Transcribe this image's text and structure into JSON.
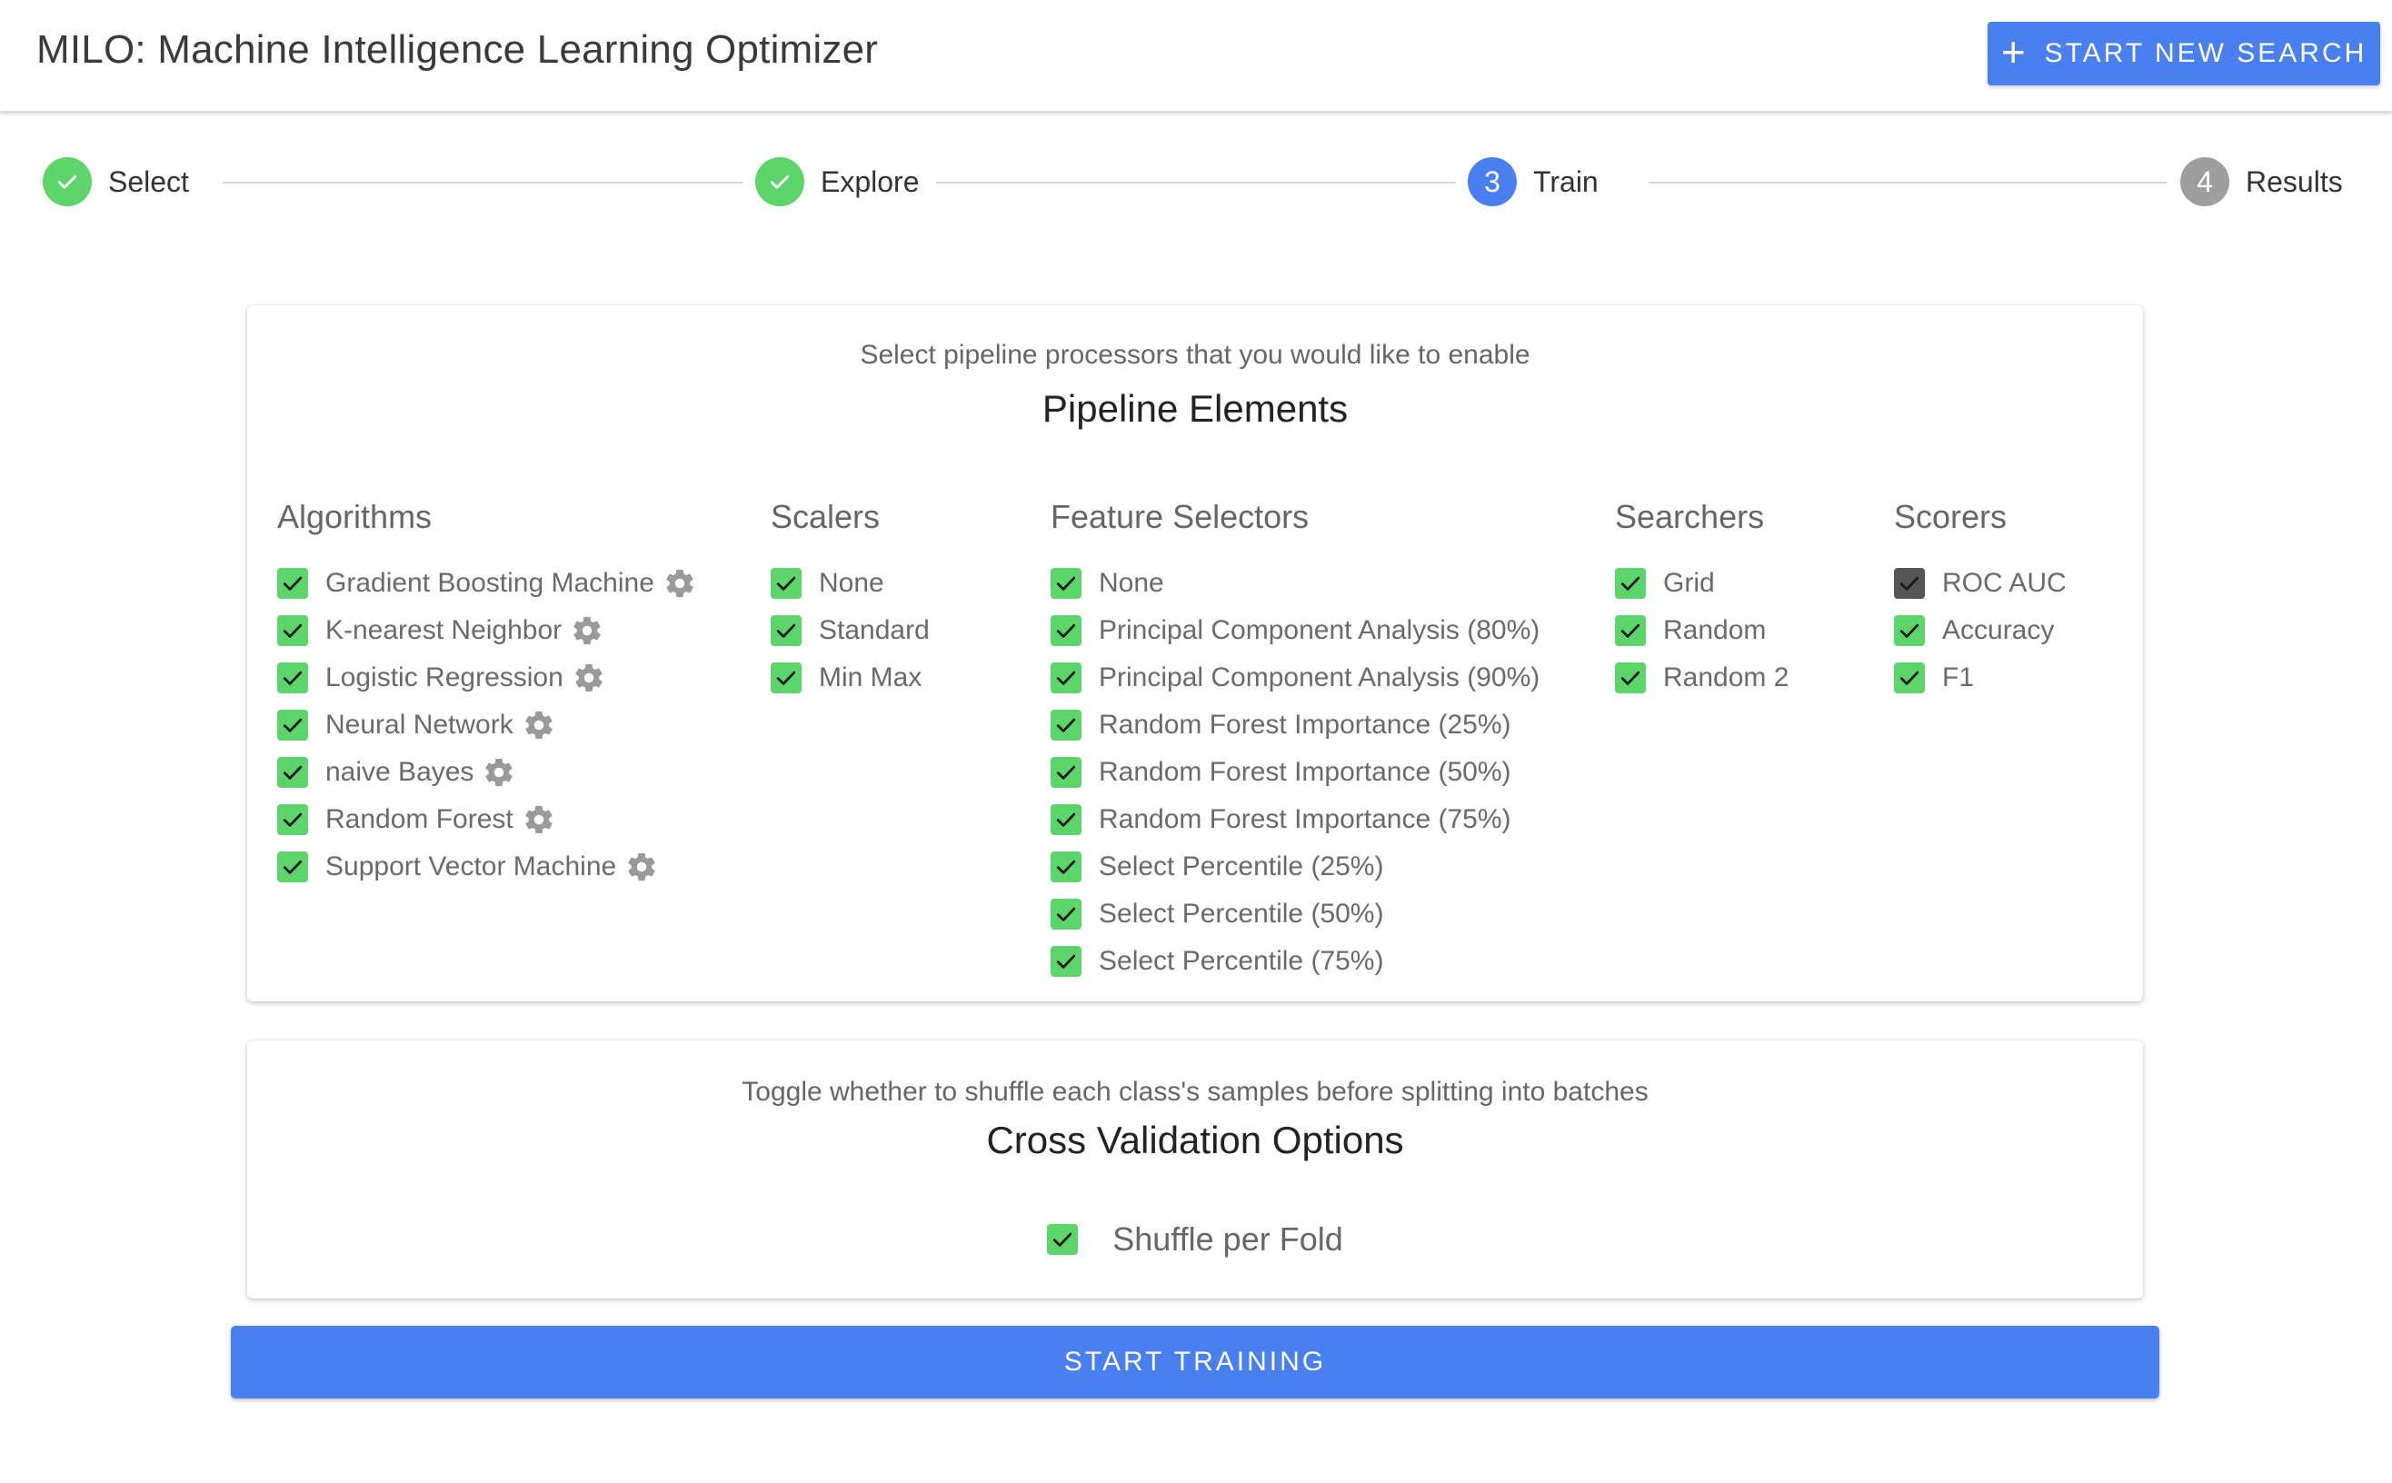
{
  "app": {
    "title": "MILO: Machine Intelligence Learning Optimizer",
    "new_search_label": "START NEW SEARCH",
    "accent_color": "#4a7ff0",
    "success_color": "#5cd56a"
  },
  "stepper": {
    "steps": [
      {
        "label": "Select",
        "state": "done",
        "icon": "check-icon"
      },
      {
        "label": "Explore",
        "state": "done",
        "icon": "check-icon"
      },
      {
        "label": "Train",
        "state": "active",
        "number": "3"
      },
      {
        "label": "Results",
        "state": "todo",
        "number": "4"
      }
    ]
  },
  "pipeline": {
    "subtitle": "Select pipeline processors that you would like to enable",
    "title": "Pipeline Elements",
    "columns": {
      "algorithms": {
        "heading": "Algorithms",
        "items": [
          {
            "label": "Gradient Boosting Machine",
            "checked": true,
            "settings_icon": "gear-icon"
          },
          {
            "label": "K-nearest Neighbor",
            "checked": true,
            "settings_icon": "gear-icon"
          },
          {
            "label": "Logistic Regression",
            "checked": true,
            "settings_icon": "gear-icon"
          },
          {
            "label": "Neural Network",
            "checked": true,
            "settings_icon": "gear-icon"
          },
          {
            "label": "naive Bayes",
            "checked": true,
            "settings_icon": "gear-icon"
          },
          {
            "label": "Random Forest",
            "checked": true,
            "settings_icon": "gear-icon"
          },
          {
            "label": "Support Vector Machine",
            "checked": true,
            "settings_icon": "gear-icon"
          }
        ]
      },
      "scalers": {
        "heading": "Scalers",
        "items": [
          {
            "label": "None",
            "checked": true
          },
          {
            "label": "Standard",
            "checked": true
          },
          {
            "label": "Min Max",
            "checked": true
          }
        ]
      },
      "feature_selectors": {
        "heading": "Feature Selectors",
        "items": [
          {
            "label": "None",
            "checked": true
          },
          {
            "label": "Principal Component Analysis (80%)",
            "checked": true
          },
          {
            "label": "Principal Component Analysis (90%)",
            "checked": true
          },
          {
            "label": "Random Forest Importance (25%)",
            "checked": true
          },
          {
            "label": "Random Forest Importance (50%)",
            "checked": true
          },
          {
            "label": "Random Forest Importance (75%)",
            "checked": true
          },
          {
            "label": "Select Percentile (25%)",
            "checked": true
          },
          {
            "label": "Select Percentile (50%)",
            "checked": true
          },
          {
            "label": "Select Percentile (75%)",
            "checked": true
          }
        ]
      },
      "searchers": {
        "heading": "Searchers",
        "items": [
          {
            "label": "Grid",
            "checked": true
          },
          {
            "label": "Random",
            "checked": true
          },
          {
            "label": "Random 2",
            "checked": true
          }
        ]
      },
      "scorers": {
        "heading": "Scorers",
        "items": [
          {
            "label": "ROC AUC",
            "checked": true,
            "disabled": true
          },
          {
            "label": "Accuracy",
            "checked": true
          },
          {
            "label": "F1",
            "checked": true
          }
        ]
      }
    }
  },
  "cross_validation": {
    "subtitle": "Toggle whether to shuffle each class's samples before splitting into batches",
    "title": "Cross Validation Options",
    "shuffle_label": "Shuffle per Fold",
    "shuffle_checked": true
  },
  "actions": {
    "start_training_label": "START TRAINING"
  }
}
